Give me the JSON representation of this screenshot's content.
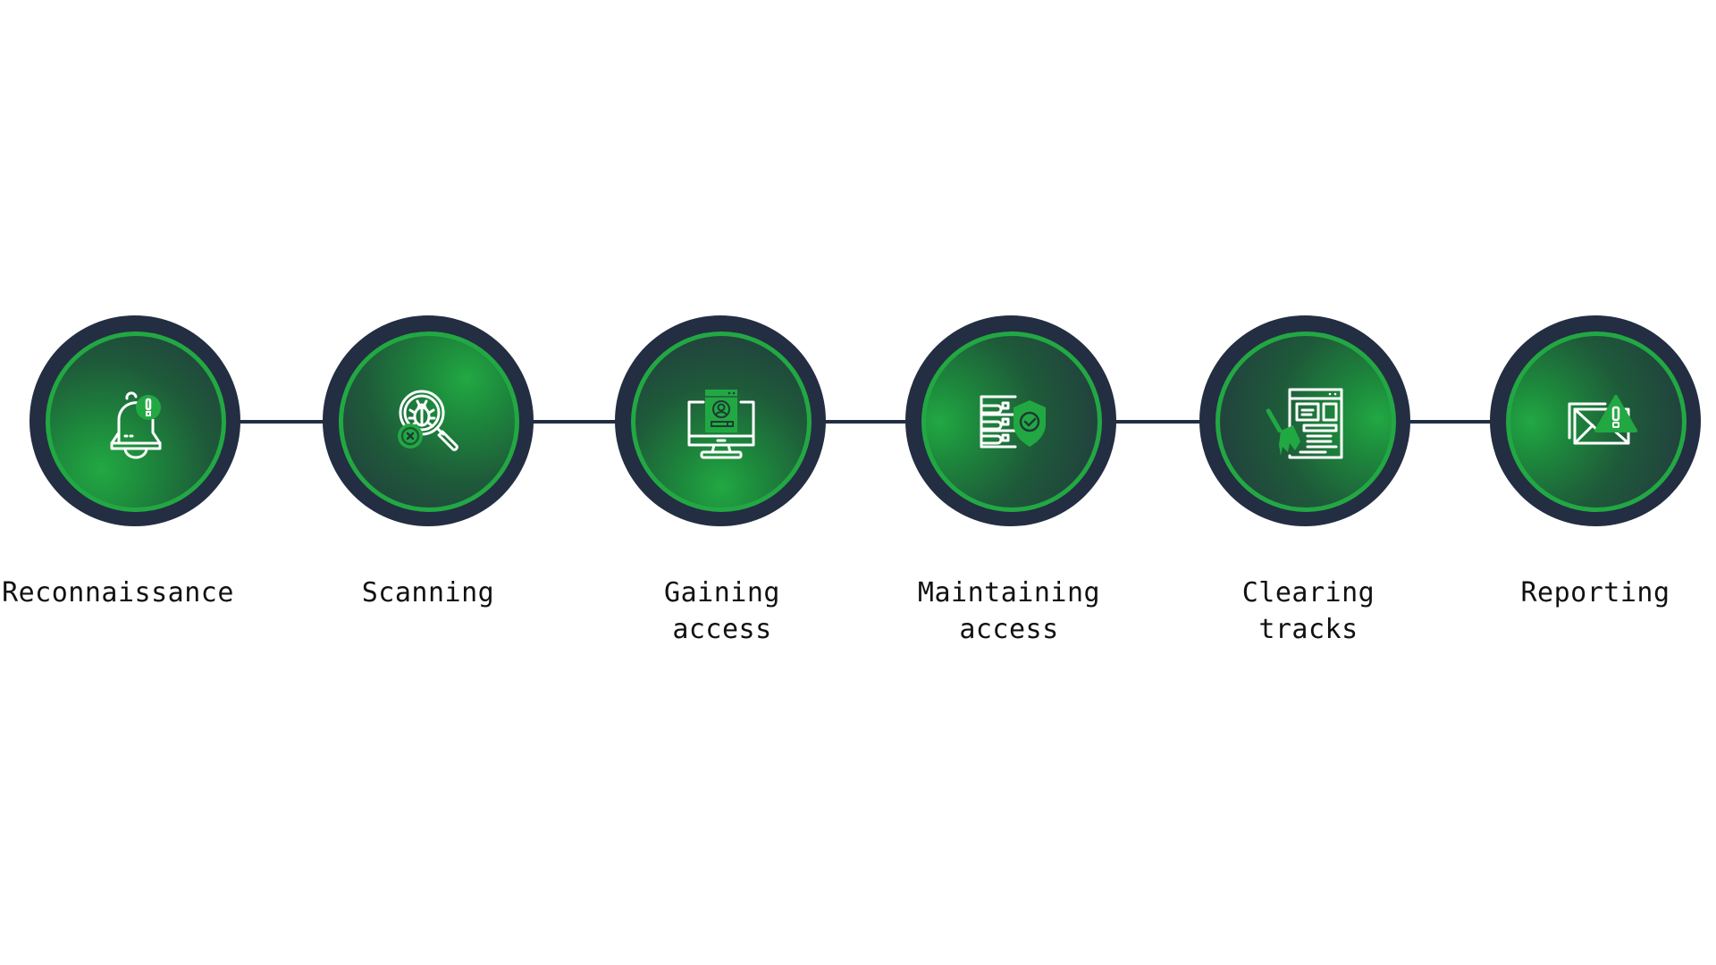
{
  "diagram": {
    "title": "",
    "colors": {
      "outer_ring": "#232e42",
      "accent_green": "#22a843",
      "glow_green": "#1fa33f",
      "icon_stroke": "#ffffff",
      "label_text": "#111111",
      "connector": "#232e42"
    },
    "steps": [
      {
        "label_line1": "Reconnaissance",
        "label_line2": "",
        "icon": "bell-alert-icon"
      },
      {
        "label_line1": "Scanning",
        "label_line2": "",
        "icon": "bug-search-icon"
      },
      {
        "label_line1": "Gaining",
        "label_line2": "access",
        "icon": "monitor-user-login-icon"
      },
      {
        "label_line1": "Maintaining",
        "label_line2": "access",
        "icon": "server-shield-icon"
      },
      {
        "label_line1": "Clearing",
        "label_line2": "tracks",
        "icon": "broom-document-icon"
      },
      {
        "label_line1": "Reporting",
        "label_line2": "",
        "icon": "mail-warning-icon"
      }
    ]
  }
}
